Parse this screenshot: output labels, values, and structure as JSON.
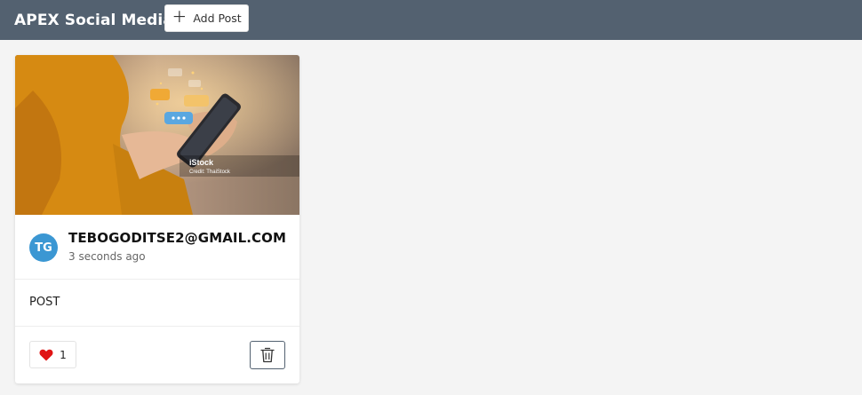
{
  "navbar": {
    "brand": "APEX Social Media",
    "add_post_label": "Add Post",
    "background": "#536170"
  },
  "post": {
    "avatar_initials": "TG",
    "avatar_color": "#3b97d3",
    "author": "TEBOGODITSE2@GMAIL.COM",
    "timestamp": "3 seconds ago",
    "text": "POST",
    "like_count": "1",
    "image": {
      "watermark": "iStock",
      "credit": "Credit: ThaiStock"
    }
  },
  "icons": {
    "add": "plus-icon",
    "like": "heart-icon",
    "delete": "trash-icon"
  }
}
